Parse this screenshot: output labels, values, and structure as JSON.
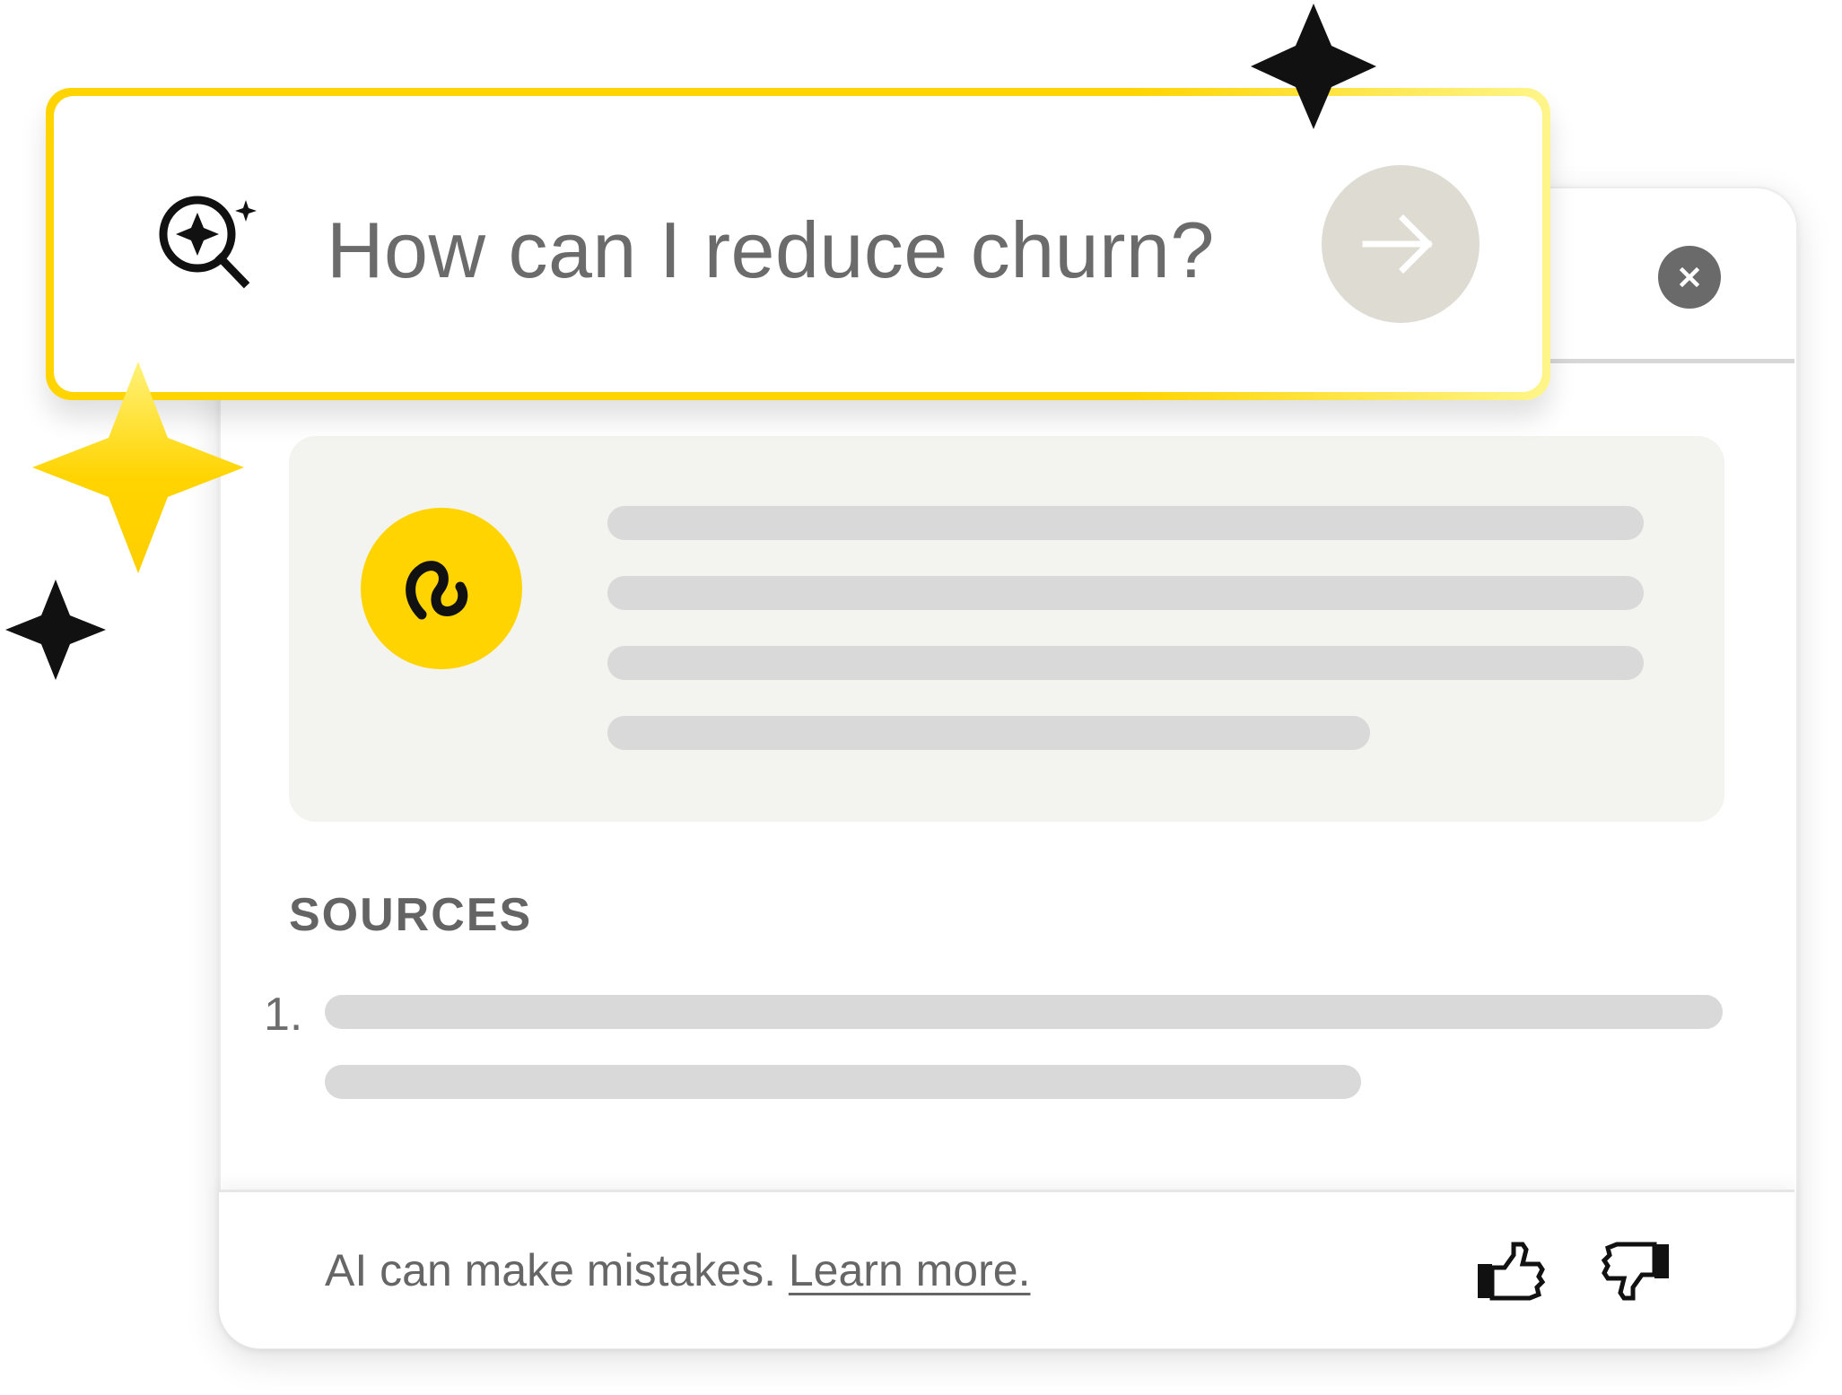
{
  "search": {
    "query": "How can I reduce churn?",
    "search_icon": "ai-search-icon",
    "submit_icon": "arrow-right-icon"
  },
  "panel": {
    "close_icon": "close-icon",
    "avatar_icon": "brand-avatar-icon"
  },
  "sources": {
    "label": "SOURCES",
    "items": [
      {
        "number": "1."
      }
    ]
  },
  "footer": {
    "disclaimer": "AI can make mistakes.",
    "learn_more": "Learn more.",
    "thumbs_up_icon": "thumbs-up-icon",
    "thumbs_down_icon": "thumbs-down-icon"
  },
  "colors": {
    "accent_yellow": "#ffd400",
    "accent_yellow_light": "#fff58a",
    "text_gray": "#666666",
    "skeleton_gray": "#d9d9d9",
    "card_bg": "#f3f3ef",
    "button_bg": "#dedbd2",
    "icon_black": "#111111"
  }
}
